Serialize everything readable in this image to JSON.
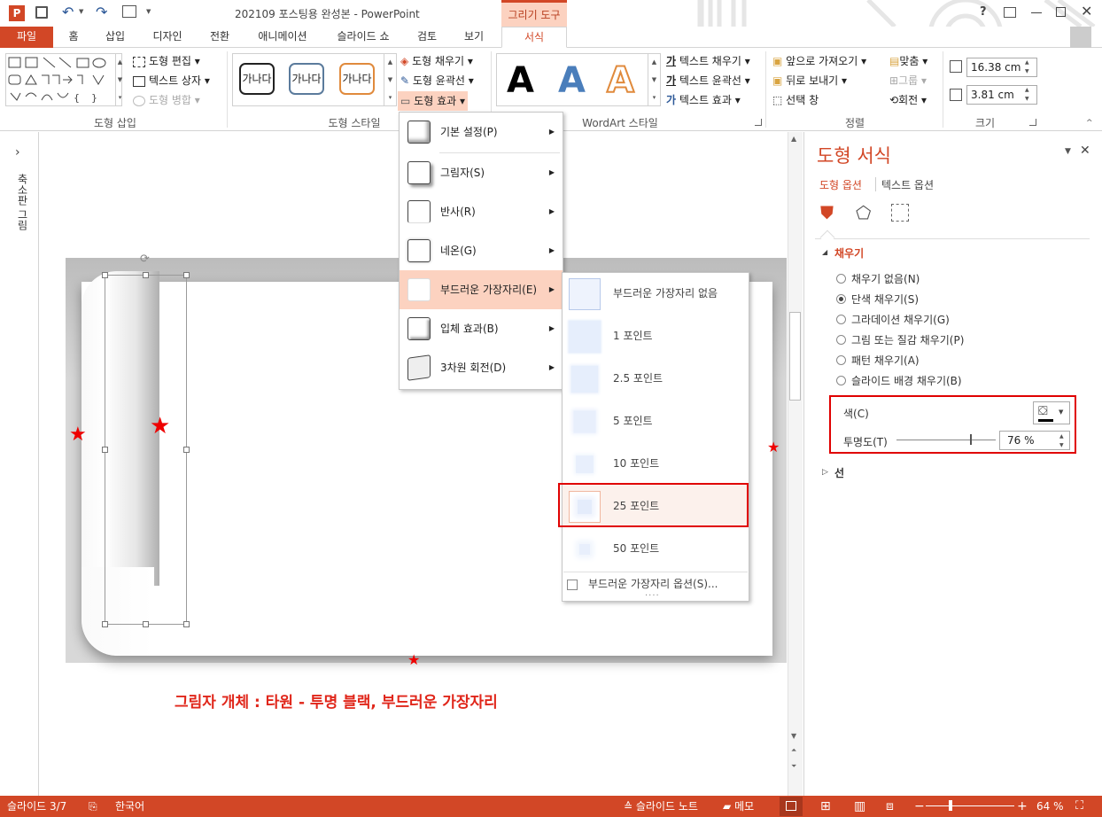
{
  "app": {
    "title": "202109 포스팅용 완성본 - PowerPoint",
    "context_tab": "그리기 도구",
    "logo": "P",
    "help": "?",
    "user": "user-avatar-icon"
  },
  "tabs": [
    "파일",
    "홈",
    "삽입",
    "디자인",
    "전환",
    "애니메이션",
    "슬라이드 쇼",
    "검토",
    "보기",
    "서식"
  ],
  "ribbon": {
    "insert_shapes": {
      "label": "도형 삽입",
      "edit_shape": "도형 편집",
      "text_box": "텍스트 상자",
      "merge_shapes": "도형 병합"
    },
    "shape_styles": {
      "label": "도형 스타일",
      "samples": [
        "가나다",
        "가나다",
        "가나다"
      ],
      "fill": "도형 채우기",
      "outline": "도형 윤곽선",
      "effects": "도형 효과"
    },
    "wordart": {
      "label": "WordArt 스타일",
      "samples": [
        "A",
        "A",
        "A"
      ],
      "text_fill": "텍스트 채우기",
      "text_outline": "텍스트 윤곽선",
      "text_effects": "텍스트 효과",
      "glyph": "가"
    },
    "arrange": {
      "label": "정렬",
      "bring_forward": "앞으로 가져오기",
      "send_backward": "뒤로 보내기",
      "selection_pane": "선택 창",
      "align": "맞춤",
      "group": "그룹",
      "rotate": "회전"
    },
    "size": {
      "label": "크기",
      "height": "16.38 cm",
      "width": "3.81 cm"
    }
  },
  "effects_menu": [
    {
      "label": "기본 설정(P)"
    },
    {
      "label": "그림자(S)"
    },
    {
      "label": "반사(R)"
    },
    {
      "label": "네온(G)"
    },
    {
      "label": "부드러운 가장자리(E)"
    },
    {
      "label": "입체 효과(B)"
    },
    {
      "label": "3차원 회전(D)"
    }
  ],
  "soft_edges_menu": {
    "items": [
      "부드러운 가장자리 없음",
      "1 포인트",
      "2.5 포인트",
      "5 포인트",
      "10 포인트",
      "25 포인트",
      "50 포인트"
    ],
    "options": "부드러운 가장자리 옵션(S)...",
    "dots": "....",
    "selected": "25 포인트"
  },
  "thumbnail_pane": {
    "label": "축소판 그림",
    "chevron": "›"
  },
  "slide": {
    "caption": "그림자 개체 : 타원 - 투명 블랙, 부드러운 가장자리",
    "star": "★"
  },
  "format_pane": {
    "title": "도형 서식",
    "tab_shape": "도형 옵션",
    "tab_text": "텍스트 옵션",
    "section_fill": "채우기",
    "options": [
      "채우기 없음(N)",
      "단색 채우기(S)",
      "그라데이션 채우기(G)",
      "그림 또는 질감 채우기(P)",
      "패턴 채우기(A)",
      "슬라이드 배경 채우기(B)"
    ],
    "selected_option": "단색 채우기(S)",
    "color_label": "색(C)",
    "transparency_label": "투명도(T)",
    "transparency_value": "76 %",
    "transparency_fraction": 0.76,
    "section_line": "선"
  },
  "status": {
    "slide": "슬라이드 3/7",
    "language": "한국어",
    "notes": "슬라이드 노트",
    "comments": "메모",
    "zoom": "64 %"
  },
  "colors": {
    "accent": "#d24726",
    "highlight": "#fcd2c0",
    "red_box": "#e00000"
  }
}
